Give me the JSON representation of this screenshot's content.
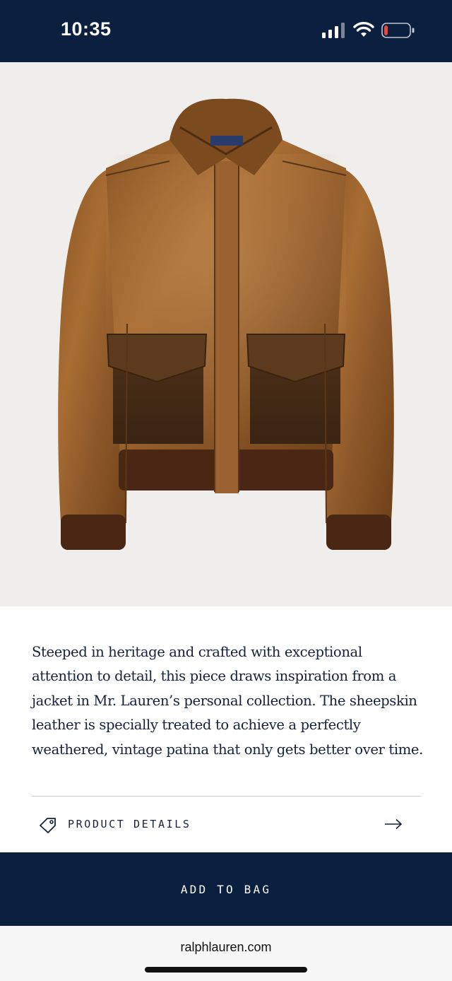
{
  "status_bar": {
    "time": "10:35",
    "background_color": "#0b1f3f",
    "icons": [
      "cellular-signal-icon",
      "wifi-icon",
      "battery-low-icon"
    ],
    "battery_level": 0.15,
    "battery_level_color": "#e8473e"
  },
  "product": {
    "image_subject": "leather flight jacket",
    "description": "Steeped in heritage and crafted with exceptional attention to detail, this piece draws inspiration from a jacket in Mr. Lauren’s personal collection. The sheepskin leather is specially treated to achieve a perfectly weathered, vintage patina that only gets better over time."
  },
  "details_row": {
    "icon": "tag-icon",
    "label": "PRODUCT DETAILS",
    "arrow": "arrow-right-icon"
  },
  "cta": {
    "label": "ADD TO BAG",
    "color": "#0b1f3f"
  },
  "browser": {
    "url": "ralphlauren.com"
  }
}
